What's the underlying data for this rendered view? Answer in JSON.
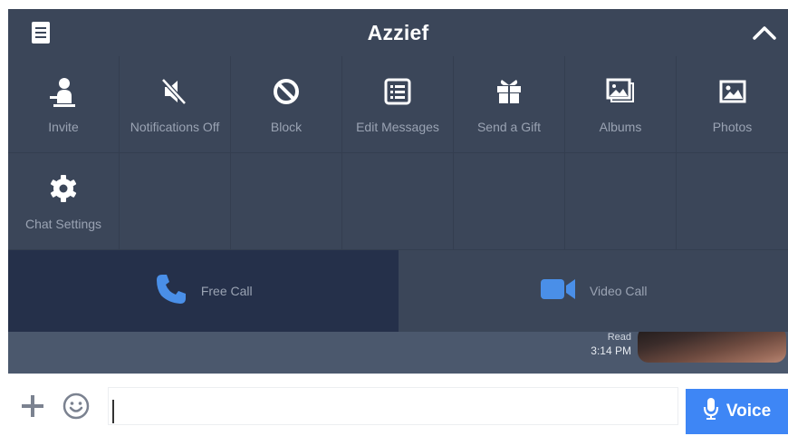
{
  "header": {
    "title": "Azzief"
  },
  "menu": {
    "items": [
      {
        "label": "Invite",
        "icon": "invite-user-icon"
      },
      {
        "label": "Notifications Off",
        "icon": "speaker-mute-icon"
      },
      {
        "label": "Block",
        "icon": "block-icon"
      },
      {
        "label": "Edit Messages",
        "icon": "list-edit-icon"
      },
      {
        "label": "Send a Gift",
        "icon": "gift-icon"
      },
      {
        "label": "Albums",
        "icon": "albums-icon"
      },
      {
        "label": "Photos",
        "icon": "photo-icon"
      },
      {
        "label": "Chat Settings",
        "icon": "gear-icon"
      }
    ]
  },
  "calls": {
    "free_label": "Free Call",
    "video_label": "Video Call"
  },
  "chat": {
    "read_label": "Read",
    "time": "3:14 PM"
  },
  "input": {
    "value": "",
    "placeholder": "",
    "voice_label": "Voice"
  },
  "colors": {
    "panel": "#3b4659",
    "free_call_bg": "#25304a",
    "call_icon": "#4a8fe8",
    "voice_button": "#3e86f5",
    "label": "#9aa3b3"
  }
}
